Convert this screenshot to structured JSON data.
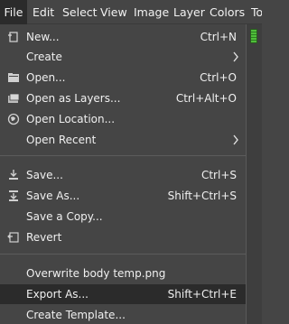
{
  "menubar": {
    "items": [
      {
        "label": "File"
      },
      {
        "label": "Edit"
      },
      {
        "label": "Select"
      },
      {
        "label": "View"
      },
      {
        "label": "Image"
      },
      {
        "label": "Layer"
      },
      {
        "label": "Colors"
      },
      {
        "label": "To"
      }
    ]
  },
  "file_menu": {
    "new": {
      "label": "New...",
      "shortcut": "Ctrl+N",
      "icon": "new-document-icon"
    },
    "create": {
      "label": "Create",
      "icon": "submenu-arrow-icon"
    },
    "open": {
      "label": "Open...",
      "shortcut": "Ctrl+O",
      "icon": "folder-open-icon"
    },
    "open_as_layers": {
      "label": "Open as Layers...",
      "shortcut": "Ctrl+Alt+O",
      "icon": "image-layers-icon"
    },
    "open_location": {
      "label": "Open Location...",
      "icon": "globe-icon"
    },
    "open_recent": {
      "label": "Open Recent",
      "icon": "submenu-arrow-icon"
    },
    "save": {
      "label": "Save...",
      "shortcut": "Ctrl+S",
      "icon": "save-icon"
    },
    "save_as": {
      "label": "Save As...",
      "shortcut": "Shift+Ctrl+S",
      "icon": "save-as-icon"
    },
    "save_copy": {
      "label": "Save a Copy..."
    },
    "revert": {
      "label": "Revert",
      "icon": "revert-icon"
    },
    "overwrite": {
      "label": "Overwrite body temp.png"
    },
    "export_as": {
      "label": "Export As...",
      "shortcut": "Shift+Ctrl+E"
    },
    "create_template": {
      "label": "Create Template..."
    }
  },
  "colors": {
    "menu_bg": "#454545",
    "highlight_bg": "#2b2b2b",
    "text": "#f0f0f0",
    "gauge_green": "#4fbf3a"
  }
}
